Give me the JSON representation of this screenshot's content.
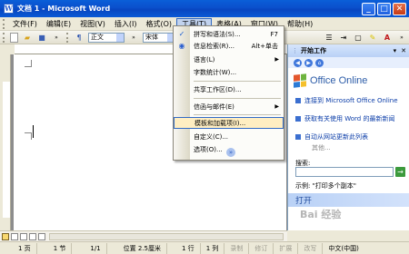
{
  "window": {
    "title": "文档 1 - Microsoft Word",
    "app_icon": "W",
    "buttons": [
      "minimize",
      "maximize",
      "close"
    ]
  },
  "menubar": {
    "items": [
      "文件(F)",
      "编辑(E)",
      "视图(V)",
      "插入(I)",
      "格式(O)",
      "工具(T)",
      "表格(A)",
      "窗口(W)",
      "帮助(H)"
    ],
    "active_index": 5
  },
  "toolbar": {
    "style": "正文",
    "font": "宋体"
  },
  "tools_menu": {
    "items": [
      {
        "label": "拼写和语法(S)...",
        "shortcut": "F7",
        "icon": "spellcheck-icon"
      },
      {
        "label": "信息检索(R)...",
        "shortcut": "Alt+单击",
        "icon": "research-icon"
      },
      {
        "label": "语言(L)",
        "submenu": true
      },
      {
        "label": "字数统计(W)..."
      },
      {
        "label": "共享工作区(D)..."
      },
      {
        "label": "信函与邮件(E)",
        "submenu": true
      },
      {
        "label": "模板和加载项(I)...",
        "highlighted": true
      },
      {
        "label": "自定义(C)..."
      },
      {
        "label": "选项(O)..."
      }
    ],
    "expand": "»"
  },
  "task_pane": {
    "title": "开始工作",
    "logo": "Office Online",
    "links": [
      "连接到 Microsoft Office Online",
      "获取有关使用 Word 的最新新闻",
      "自动从网站更新此列表"
    ],
    "more": "其他...",
    "search_label": "搜索:",
    "example": "示例:  \"打印多个副本\"",
    "open_header": "打开"
  },
  "statusbar": {
    "page": "1 页",
    "section": "1 节",
    "page_of": "1/1",
    "position": "位置 2.5厘米",
    "line": "1 行",
    "column": "1 列",
    "modes": [
      "录制",
      "修订",
      "扩展",
      "改写"
    ],
    "language": "中文(中国)"
  },
  "watermark": "Bai 经验",
  "colors": {
    "titlebar": "#0A4FCC",
    "highlight": "#FFEEC2",
    "menu_active": "#C1D2EE"
  }
}
